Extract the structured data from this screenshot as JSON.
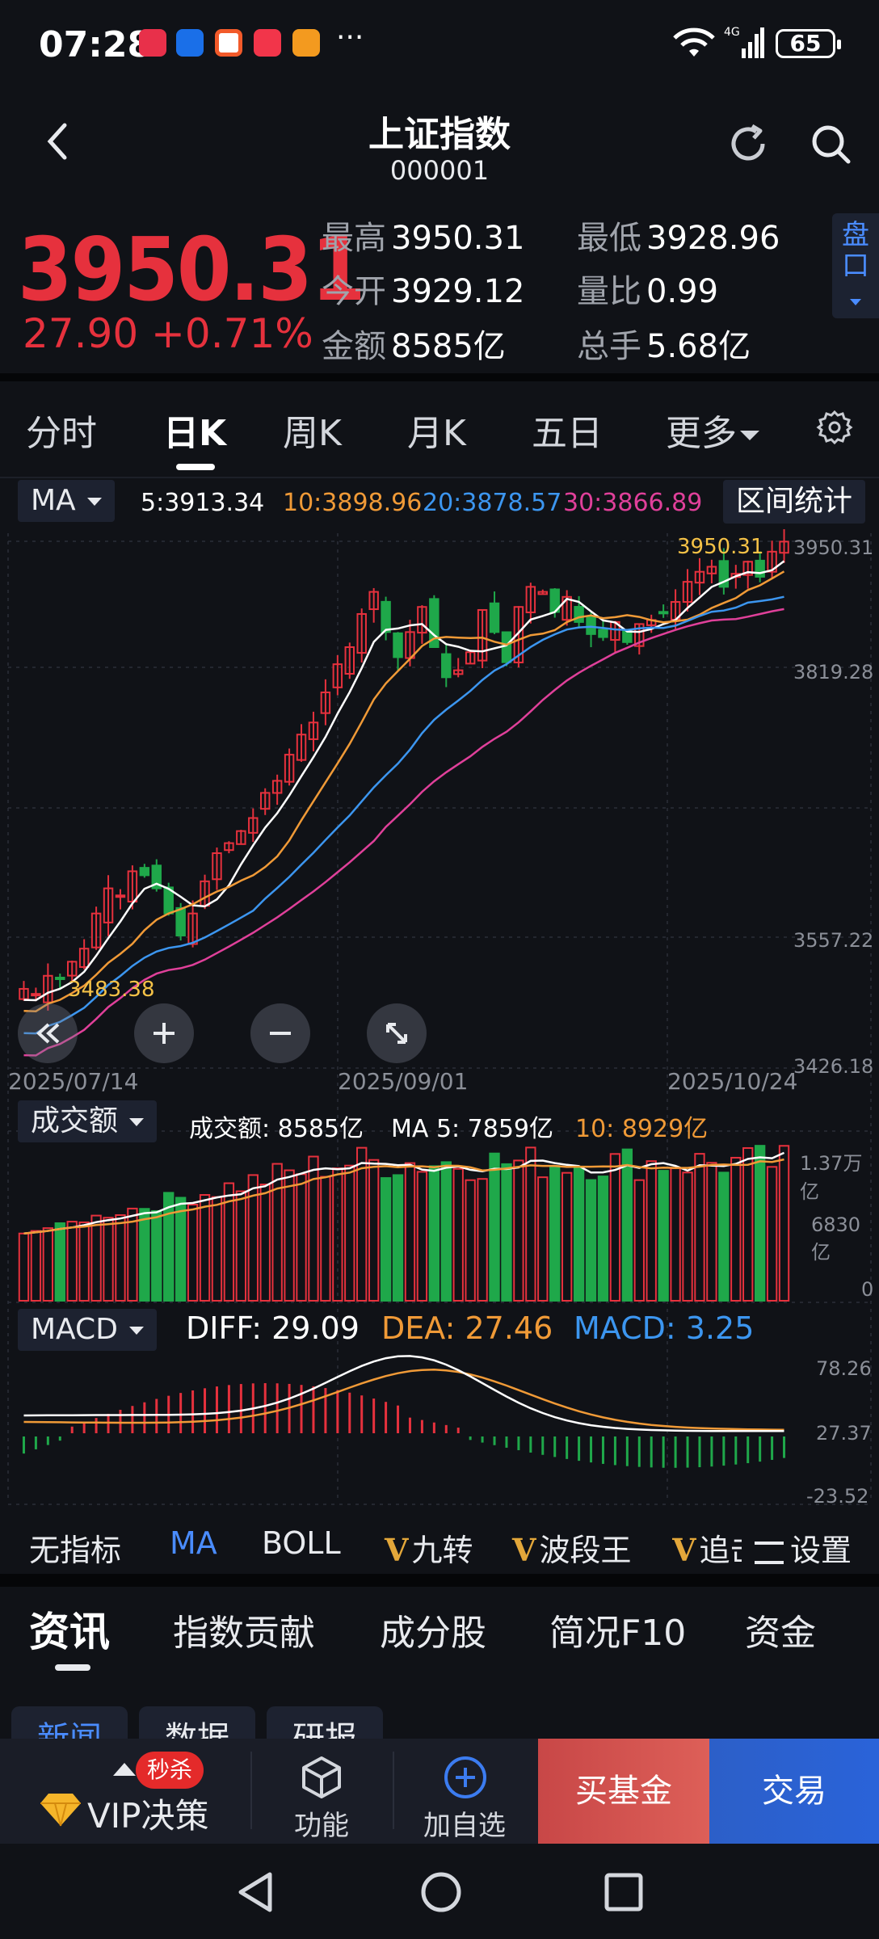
{
  "status": {
    "time": "07:28",
    "more": "···",
    "battery": "65"
  },
  "header": {
    "title": "上证指数",
    "code": "000001"
  },
  "quote": {
    "price": "3950.31",
    "change": "27.90  +0.71%",
    "stats": [
      {
        "label": "最高",
        "value": "3950.31"
      },
      {
        "label": "最低",
        "value": "3928.96"
      },
      {
        "label": "今开",
        "value": "3929.12"
      },
      {
        "label": "量比",
        "value": "0.99"
      },
      {
        "label": "金额",
        "value": "8585亿"
      },
      {
        "label": "总手",
        "value": "5.68亿"
      }
    ],
    "pankou": "盘口"
  },
  "chart_tabs": [
    "分时",
    "日K",
    "周K",
    "月K",
    "五日",
    "更多"
  ],
  "ma_row": {
    "selector": "MA",
    "ma5": "5:3913.34",
    "ma10": "10:3898.96",
    "ma20": "20:3878.57",
    "ma30": "30:3866.89",
    "range_button": "区间统计"
  },
  "colors": {
    "up": "#e6313d",
    "down": "#1fa84a",
    "ma5": "#ffffff",
    "ma10": "#f09a37",
    "ma20": "#3c96f0",
    "ma30": "#e0409a",
    "accent": "#2a63d9"
  },
  "chart_data": {
    "type": "candlestick",
    "y_ticks": [
      "3950.31",
      "3819.28",
      "3557.22",
      "3426.18"
    ],
    "ylim": [
      3426.18,
      3950.31
    ],
    "x_ticks": [
      "2025/07/14",
      "2025/09/01",
      "2025/10/24"
    ],
    "annotations": {
      "high": "3950.31",
      "low": "3483.38"
    },
    "series": [
      {
        "name": "MA5",
        "last": 3913.34
      },
      {
        "name": "MA10",
        "last": 3898.96
      },
      {
        "name": "MA20",
        "last": 3878.57
      },
      {
        "name": "MA30",
        "last": 3866.89
      }
    ],
    "closes": [
      3505,
      3500,
      3518,
      3515,
      3532,
      3545,
      3580,
      3605,
      3598,
      3622,
      3618,
      3605,
      3580,
      3558,
      3580,
      3612,
      3640,
      3650,
      3662,
      3675,
      3700,
      3712,
      3738,
      3758,
      3770,
      3800,
      3828,
      3845,
      3878,
      3900,
      3860,
      3835,
      3860,
      3885,
      3845,
      3815,
      3822,
      3840,
      3882,
      3860,
      3830,
      3885,
      3905,
      3900,
      3880,
      3895,
      3870,
      3858,
      3855,
      3870,
      3850,
      3868,
      3872,
      3880,
      3890,
      3910,
      3920,
      3925,
      3905,
      3918,
      3930,
      3915,
      3940,
      3950
    ],
    "volume": {
      "labels": [
        "成交额: 8585亿",
        "MA 5: 7859亿",
        "10: 8929亿"
      ],
      "y_ticks": [
        "1.37万亿",
        "6830亿",
        "0"
      ]
    },
    "macd": {
      "diff": "DIFF: 29.09",
      "dea": "DEA: 27.46",
      "macd": "MACD: 3.25",
      "y_ticks": [
        "78.26",
        "27.37",
        "-23.52"
      ]
    }
  },
  "volume_selector": "成交额",
  "macd_selector": "MACD",
  "indicators": [
    "无指标",
    "MA",
    "BOLL",
    "九转",
    "波段王",
    "追击",
    "设置"
  ],
  "info_tabs": [
    "资讯",
    "指数贡献",
    "成分股",
    "简况F10",
    "资金"
  ],
  "info_subtabs": [
    "新闻",
    "数据",
    "研报"
  ],
  "bottom": {
    "badge": "秒杀",
    "vip": "VIP决策",
    "func": "功能",
    "add": "加自选",
    "buy": "买基金",
    "trade": "交易"
  }
}
